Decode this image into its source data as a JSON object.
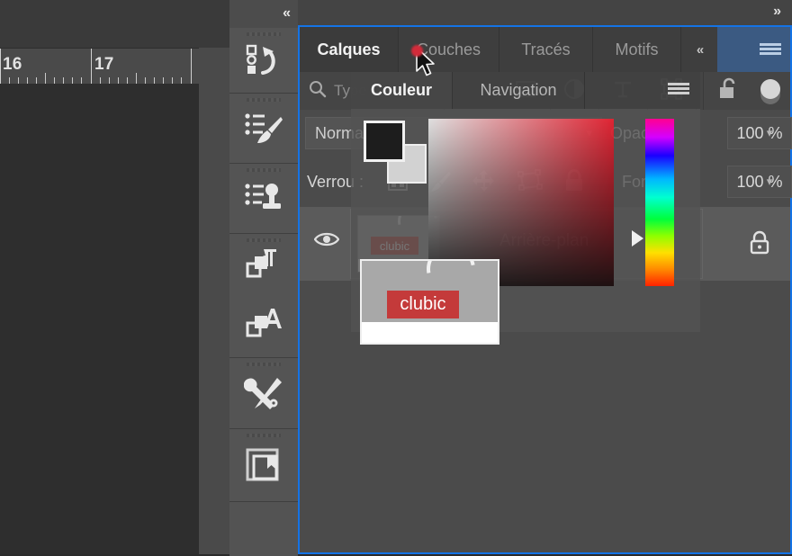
{
  "app": {
    "name": "photo-editor",
    "accent": "#1473e6",
    "panel_bg": "#4b4b4b",
    "tab_active_bg": "#3b3b3b",
    "tabbar_bg": "#3b5a82"
  },
  "canvas": {
    "ruler": {
      "labels": [
        "16",
        "17"
      ],
      "unit": "cm"
    }
  },
  "rail": {
    "collapse_label": "«",
    "groups": [
      {
        "items": [
          {
            "icon": "history-icon"
          }
        ]
      },
      {
        "items": [
          {
            "icon": "brush-presets-icon"
          }
        ]
      },
      {
        "items": [
          {
            "icon": "clone-stamp-presets-icon"
          }
        ]
      },
      {
        "items": [
          {
            "icon": "paragraph-styles-icon"
          },
          {
            "icon": "character-styles-icon"
          }
        ]
      },
      {
        "items": [
          {
            "icon": "tools-icon"
          }
        ]
      },
      {
        "items": [
          {
            "icon": "libraries-icon"
          }
        ]
      }
    ]
  },
  "dock": {
    "expand_label": "»",
    "menu_icon": "hamburger-menu-icon",
    "tabs": [
      {
        "label": "Calques",
        "active": true
      },
      {
        "label": "Couches",
        "active": false
      },
      {
        "label": "Tracés",
        "active": false
      },
      {
        "label": "Motifs",
        "active": false
      }
    ],
    "tabs_collapse_label": "«"
  },
  "layers_panel": {
    "filter": {
      "search_icon": "search-icon",
      "placeholder": "Type",
      "kind_value": "Type",
      "icons": [
        "pixel-filter-icon",
        "adjustment-filter-icon",
        "type-filter-icon",
        "shape-filter-icon"
      ],
      "lock_icon": "smart-filter-lock-icon",
      "toggle_icon": "filter-toggle-switch"
    },
    "blend": {
      "mode_label": "Normal",
      "opacity_label": "Opacité :",
      "opacity_value": "100 %",
      "caret_icon": "chevron-down-icon"
    },
    "lock": {
      "label": "Verrou :",
      "icons": [
        "lock-transparency-icon",
        "lock-image-pixels-icon",
        "lock-position-icon",
        "lock-artboard-icon",
        "lock-all-icon"
      ],
      "fill_label": "Fond :",
      "fill_value": "100 %"
    },
    "layers": [
      {
        "name": "Arrière-plan",
        "visible": true,
        "locked": true,
        "visibility_icon": "eye-icon",
        "lock_icon": "lock-icon",
        "thumbnail_badge": "clubic"
      }
    ]
  },
  "color_panel": {
    "tabs": [
      {
        "label": "Couleur",
        "active": true
      },
      {
        "label": "Navigation",
        "active": false
      }
    ],
    "menu_icon": "panel-menu-icon",
    "foreground_color": "#1d1d1d",
    "background_color": "#d2d2d2",
    "hue": "#ff1b2d",
    "picker_icon": "saturation-value-square",
    "hue_slider_icon": "hue-strip",
    "preview_badge": "clubic"
  },
  "cursor": {
    "icon": "arrow-cursor"
  }
}
